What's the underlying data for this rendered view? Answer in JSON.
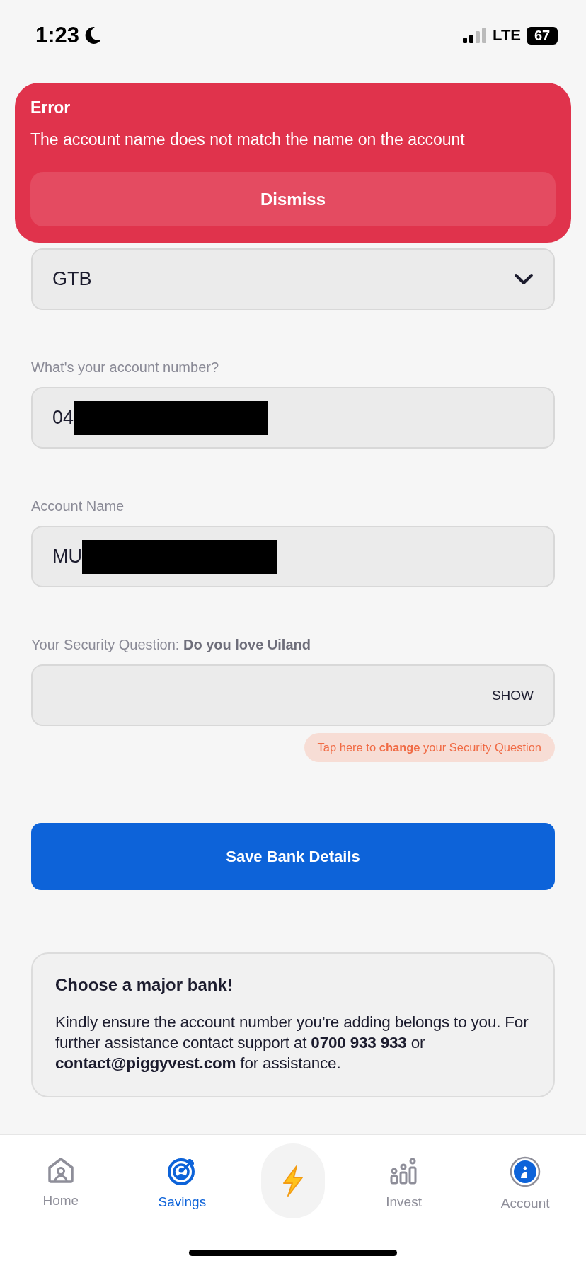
{
  "status_bar": {
    "time": "1:23",
    "network": "LTE",
    "battery": "67"
  },
  "error_toast": {
    "title": "Error",
    "message": "The account name does not match the name on the account",
    "button": "Dismiss"
  },
  "fields": [
    {
      "kind": "select",
      "value": "GTB"
    },
    {
      "kind": "text",
      "label": "What's your account number?",
      "value": "04",
      "redacted": true
    },
    {
      "kind": "text",
      "label": "Account Name",
      "value": "MU",
      "redacted": true
    },
    {
      "kind": "secret",
      "label": "Your Security Question: **Do you love Uiland**",
      "action": "SHOW"
    }
  ],
  "change_question_link": "Tap here to **change** your Security Question",
  "save_button": "Save Bank Details",
  "info_card": {
    "title": "Choose a major bank!",
    "body": "Kindly ensure the account number you’re adding belongs to you. For further assistance contact support at **0700 933 933** or **contact@piggyvest.com** for assistance."
  },
  "tab_bar": [
    {
      "label": "Home",
      "selected": false
    },
    {
      "label": "Savings",
      "selected": true
    },
    {
      "label": "Invest",
      "selected": false
    },
    {
      "label": "Account",
      "selected": false
    }
  ]
}
